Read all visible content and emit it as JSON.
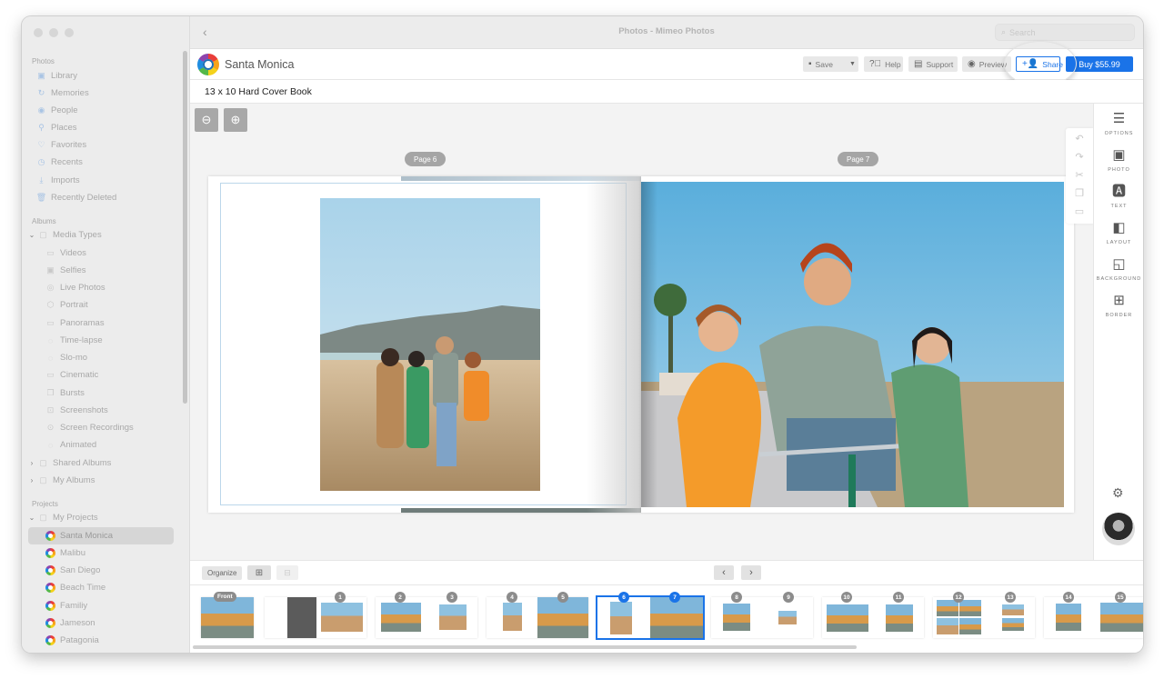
{
  "window": {
    "title": "Photos - Mimeo Photos",
    "search_placeholder": "Search"
  },
  "sidebar": {
    "sections": [
      {
        "label": "Photos"
      },
      {
        "label": "Albums"
      },
      {
        "label": "Projects"
      }
    ],
    "photos_items": [
      {
        "label": "Library",
        "icon": "library-icon"
      },
      {
        "label": "Memories",
        "icon": "memories-icon"
      },
      {
        "label": "People",
        "icon": "people-icon"
      },
      {
        "label": "Places",
        "icon": "places-icon"
      },
      {
        "label": "Favorites",
        "icon": "heart-icon"
      },
      {
        "label": "Recents",
        "icon": "clock-icon"
      },
      {
        "label": "Imports",
        "icon": "import-icon"
      },
      {
        "label": "Recently Deleted",
        "icon": "trash-icon"
      }
    ],
    "media_types": {
      "label": "Media Types",
      "items": [
        {
          "label": "Videos",
          "icon": "video-icon"
        },
        {
          "label": "Selfies",
          "icon": "selfie-icon"
        },
        {
          "label": "Live Photos",
          "icon": "live-photo-icon"
        },
        {
          "label": "Portrait",
          "icon": "portrait-icon"
        },
        {
          "label": "Panoramas",
          "icon": "panorama-icon"
        },
        {
          "label": "Time-lapse",
          "icon": "timelapse-icon"
        },
        {
          "label": "Slo-mo",
          "icon": "slomo-icon"
        },
        {
          "label": "Cinematic",
          "icon": "cinematic-icon"
        },
        {
          "label": "Bursts",
          "icon": "bursts-icon"
        },
        {
          "label": "Screenshots",
          "icon": "screenshot-icon"
        },
        {
          "label": "Screen Recordings",
          "icon": "screen-recording-icon"
        },
        {
          "label": "Animated",
          "icon": "animated-icon"
        }
      ]
    },
    "shared_albums": "Shared Albums",
    "my_albums": "My Albums",
    "my_projects": {
      "label": "My Projects",
      "items": [
        {
          "label": "Santa Monica",
          "selected": true
        },
        {
          "label": "Malibu"
        },
        {
          "label": "San Diego"
        },
        {
          "label": "Beach Time"
        },
        {
          "label": "Familiy"
        },
        {
          "label": "Jameson"
        },
        {
          "label": "Patagonia"
        }
      ]
    }
  },
  "appbar": {
    "project_name": "Santa Monica",
    "save": "Save",
    "help": "Help",
    "support": "Support",
    "preview": "Preview",
    "share": "Share",
    "buy": "Buy $55.99"
  },
  "book": {
    "title": "13 x 10 Hard Cover Book",
    "left_page_label": "Page 6",
    "right_page_label": "Page 7"
  },
  "right_panel": {
    "items": [
      {
        "label": "OPTIONS",
        "icon": "sliders-icon"
      },
      {
        "label": "PHOTO",
        "icon": "photo-icon"
      },
      {
        "label": "TEXT",
        "icon": "text-icon"
      },
      {
        "label": "LAYOUT",
        "icon": "layout-icon"
      },
      {
        "label": "BACKGROUND",
        "icon": "background-icon"
      },
      {
        "label": "BORDER",
        "icon": "border-icon"
      }
    ]
  },
  "bottombar": {
    "organize": "Organize"
  },
  "thumbnails": {
    "front_label": "Front",
    "pages": [
      "1",
      "2",
      "3",
      "4",
      "5",
      "6",
      "7",
      "8",
      "9",
      "10",
      "11",
      "12",
      "13",
      "14",
      "15"
    ],
    "selected_pages": [
      "6",
      "7"
    ]
  },
  "colors": {
    "accent": "#1a73e8"
  }
}
